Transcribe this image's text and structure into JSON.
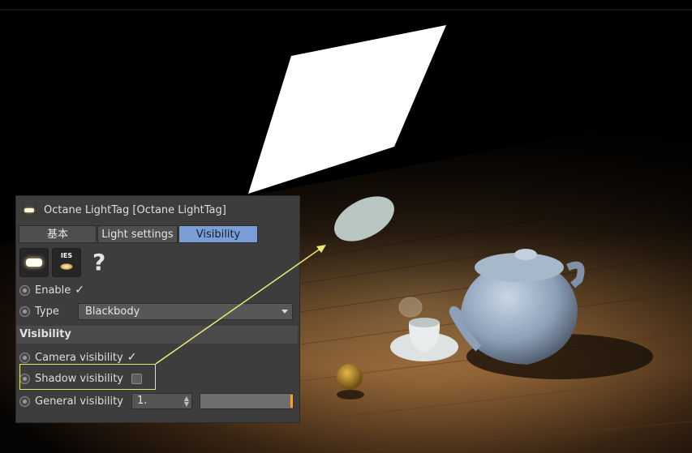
{
  "panel": {
    "title": "Octane LightTag [Octane LightTag]",
    "tabs": [
      {
        "label": "基本",
        "active": false
      },
      {
        "label": "Light settings",
        "active": false
      },
      {
        "label": "Visibility",
        "active": true
      }
    ],
    "icons": [
      "emissive-light-icon",
      "ies-light-icon",
      "help-icon"
    ],
    "ies_text": "IES",
    "help_glyph": "?",
    "enable": {
      "label": "Enable",
      "checked": true
    },
    "type": {
      "label": "Type",
      "value": "Blackbody"
    },
    "section_title": "Visibility",
    "camera_visibility": {
      "label": "Camera visibility",
      "checked": true
    },
    "shadow_visibility": {
      "label": "Shadow visibility",
      "checked": false
    },
    "general_visibility": {
      "label": "General visibility",
      "value": "1."
    }
  },
  "colors": {
    "panel_bg": "#3d3d3d",
    "active_tab": "#7c9ed6",
    "highlight": "#e7ea74",
    "slider_accent": "#f2a22d"
  }
}
